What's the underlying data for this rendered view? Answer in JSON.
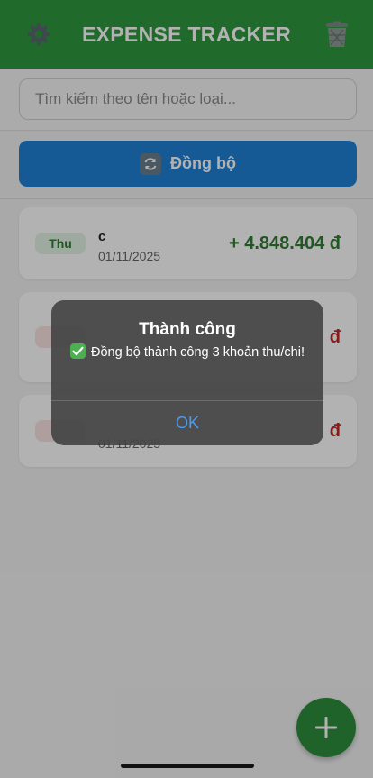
{
  "app": {
    "title": "EXPENSE TRACKER",
    "header_color": "#2e9a3e",
    "icons": {
      "settings": "gear-icon",
      "delete_all": "trash-icon",
      "sync": "sync-icon",
      "add": "plus-icon"
    }
  },
  "search": {
    "placeholder": "Tìm kiếm theo tên hoặc loại...",
    "value": ""
  },
  "sync": {
    "label": "Đồng bộ",
    "color": "#1f82d6"
  },
  "transactions": [
    {
      "type_label": "Thu",
      "name": "c",
      "date": "01/11/2025",
      "amount": "+ 4.848.404 đ",
      "kind": "income"
    },
    {
      "type_label": "",
      "name": "",
      "date": "",
      "amount": "đ",
      "kind": "expense"
    },
    {
      "type_label": "",
      "name": "",
      "date": "01/11/2025",
      "amount": "đ",
      "kind": "expense"
    }
  ],
  "alert": {
    "title": "Thành công",
    "message_icon": "check-mark-icon",
    "message": "Đồng bộ thành công 3 khoản thu/chi!",
    "ok_label": "OK"
  },
  "colors": {
    "income": "#2e7d32",
    "expense": "#c62828",
    "fab": "#2f8f3d",
    "alert_button": "#4a9df0"
  }
}
